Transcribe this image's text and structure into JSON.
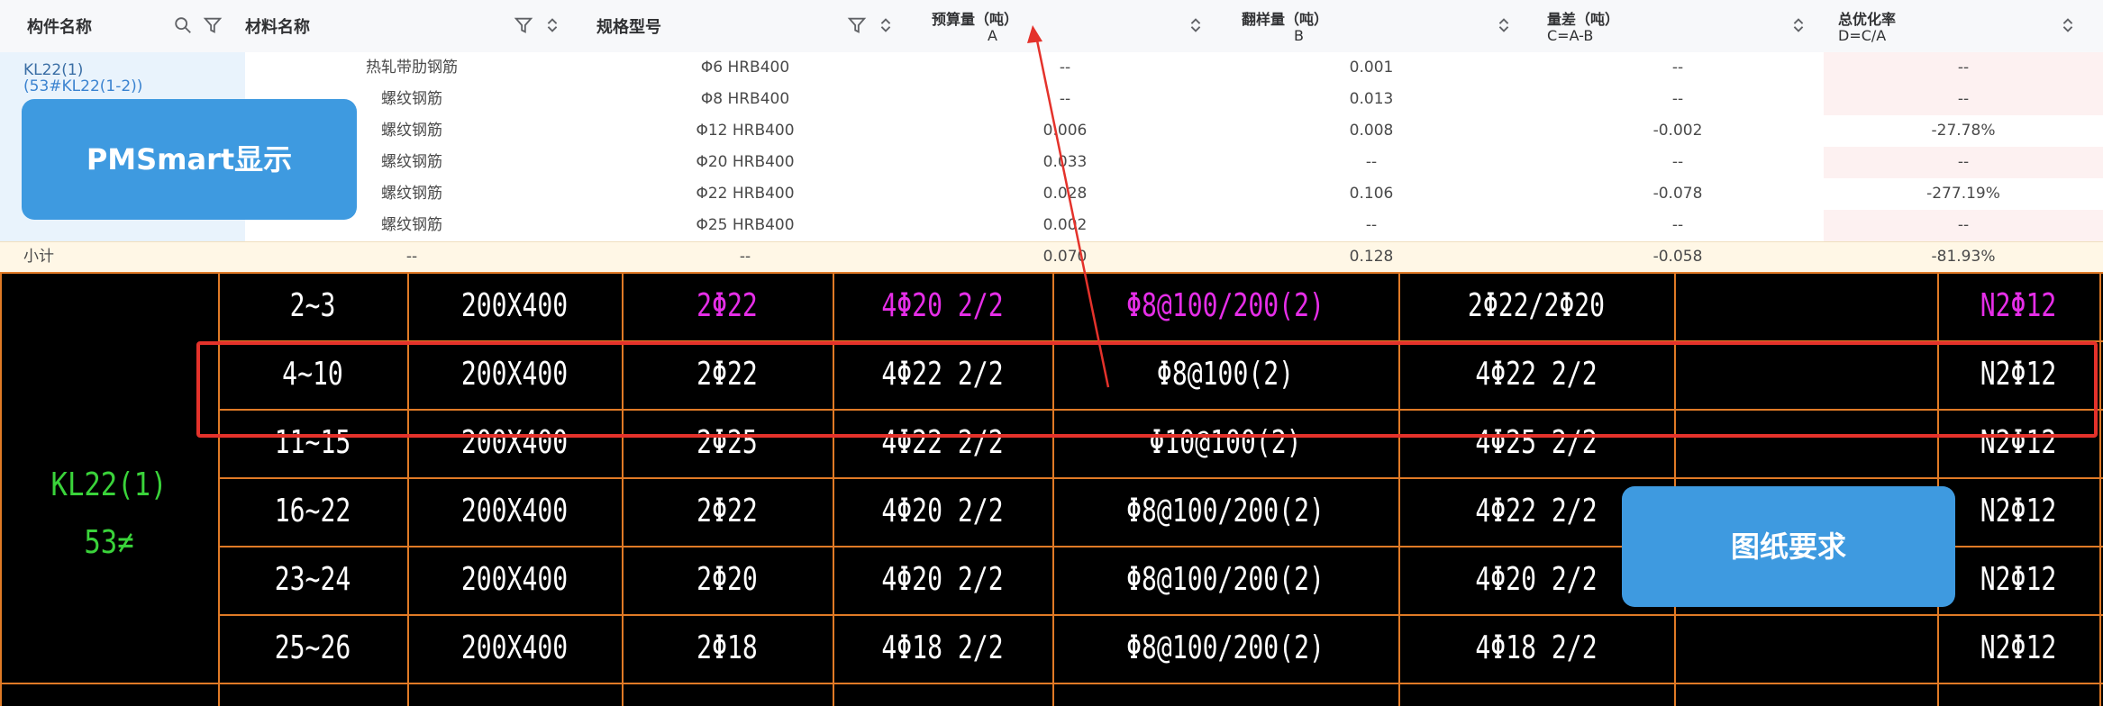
{
  "table": {
    "headers": {
      "component": "构件名称",
      "material": "材料名称",
      "spec": "规格型号",
      "budget": {
        "title": "预算量（吨）",
        "sub": "A"
      },
      "sample": {
        "title": "翻样量（吨）",
        "sub": "B"
      },
      "diff": {
        "title": "量差（吨）",
        "sub": "C=A-B"
      },
      "rate": {
        "title": "总优化率",
        "sub": "D=C/A"
      }
    },
    "component_name": "KL22(1)",
    "component_sub": "(53#KL22(1-2))",
    "rows": [
      {
        "material": "热轧带肋钢筋",
        "spec": "Φ6 HRB400",
        "a": "--",
        "b": "0.001",
        "c": "--",
        "d": "--"
      },
      {
        "material": "螺纹钢筋",
        "spec": "Φ8 HRB400",
        "a": "--",
        "b": "0.013",
        "c": "--",
        "d": "--"
      },
      {
        "material": "螺纹钢筋",
        "spec": "Φ12 HRB400",
        "a": "0.006",
        "b": "0.008",
        "c": "-0.002",
        "d": "-27.78%"
      },
      {
        "material": "螺纹钢筋",
        "spec": "Φ20 HRB400",
        "a": "0.033",
        "b": "--",
        "c": "--",
        "d": "--"
      },
      {
        "material": "螺纹钢筋",
        "spec": "Φ22 HRB400",
        "a": "0.028",
        "b": "0.106",
        "c": "-0.078",
        "d": "-277.19%"
      },
      {
        "material": "螺纹钢筋",
        "spec": "Φ25 HRB400",
        "a": "0.002",
        "b": "--",
        "c": "--",
        "d": "--"
      }
    ],
    "subtotal": {
      "label": "小计",
      "material": "--",
      "spec": "--",
      "a": "0.070",
      "b": "0.128",
      "c": "-0.058",
      "d": "-81.93%"
    }
  },
  "callouts": {
    "pmsmart": "PMSmart显示",
    "drawing": "图纸要求"
  },
  "drawing": {
    "beam_name": "KL22(1)",
    "beam_no": "53≠",
    "rows": [
      {
        "span": "2~3",
        "section": "200X400",
        "top": "2Φ22",
        "bottom": "4Φ20 2/2",
        "stirrup": "Φ8@100/200(2)",
        "extra": "2Φ22/2Φ20",
        "waist": "N2Φ12",
        "highlight": true
      },
      {
        "span": "4~10",
        "section": "200X400",
        "top": "2Φ22",
        "bottom": "4Φ22 2/2",
        "stirrup": "Φ8@100(2)",
        "extra": "4Φ22 2/2",
        "waist": "N2Φ12",
        "highlight": false
      },
      {
        "span": "11~15",
        "section": "200X400",
        "top": "2Φ25",
        "bottom": "4Φ22 2/2",
        "stirrup": "Φ10@100(2)",
        "extra": "4Φ25 2/2",
        "waist": "N2Φ12",
        "highlight": false
      },
      {
        "span": "16~22",
        "section": "200X400",
        "top": "2Φ22",
        "bottom": "4Φ20 2/2",
        "stirrup": "Φ8@100/200(2)",
        "extra": "4Φ22 2/2",
        "waist": "N2Φ12",
        "highlight": false
      },
      {
        "span": "23~24",
        "section": "200X400",
        "top": "2Φ20",
        "bottom": "4Φ20 2/2",
        "stirrup": "Φ8@100/200(2)",
        "extra": "4Φ20 2/2",
        "waist": "N2Φ12",
        "highlight": false
      },
      {
        "span": "25~26",
        "section": "200X400",
        "top": "2Φ18",
        "bottom": "4Φ18 2/2",
        "stirrup": "Φ8@100/200(2)",
        "extra": "4Φ18 2/2",
        "waist": "N2Φ12",
        "highlight": false
      }
    ]
  },
  "colors": {
    "accent": "#3e9ae0",
    "highlight_box": "#e4322b",
    "arrow": "#e4322b",
    "cad_line": "#e07a26",
    "cad_magenta": "#e62ee8",
    "cad_green": "#3ad33a"
  },
  "icons": [
    "search-icon",
    "filter-icon",
    "sort-icon"
  ]
}
